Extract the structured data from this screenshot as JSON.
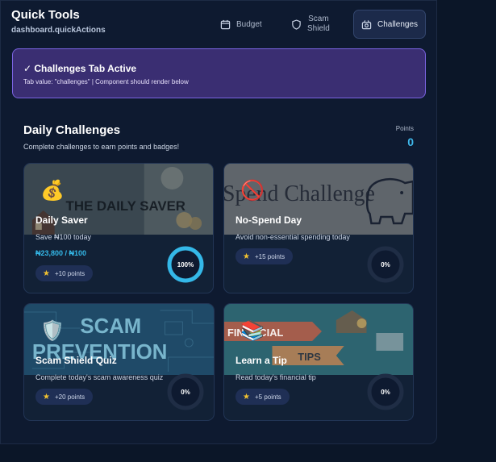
{
  "header": {
    "title": "Quick Tools",
    "subtitle": "dashboard.quickActions",
    "tabs": [
      {
        "label": "Budget",
        "icon": "calendar-icon"
      },
      {
        "label": "Scam Shield",
        "line1": "Scam",
        "line2": "Shield",
        "icon": "shield-icon"
      },
      {
        "label": "Challenges",
        "icon": "challenges-icon",
        "active": true
      }
    ]
  },
  "banner": {
    "title": "✓ Challenges Tab Active",
    "text": "Tab value: \"challenges\" | Component should render below"
  },
  "section": {
    "title": "Daily Challenges",
    "subtitle": "Complete challenges to earn points and badges!",
    "points_label": "Points",
    "points_value": "0"
  },
  "challenges": [
    {
      "title": "Daily Saver",
      "description": "Save ₦100 today",
      "progress_text": "₦23,800 / ₦100",
      "points": "+10 points",
      "percent": 100,
      "percent_label": "100%",
      "emoji": "💰",
      "emoji_icon": "money-bag-icon",
      "image_text": "THE DAILY SAVER"
    },
    {
      "title": "No-Spend Day",
      "description": "Avoid non-essential spending today",
      "points": "+15 points",
      "percent": 0,
      "percent_label": "0%",
      "emoji": "🚫",
      "emoji_icon": "prohibited-icon",
      "image_text": "Spend Challenge"
    },
    {
      "title": "Scam Shield Quiz",
      "description": "Complete today's scam awareness quiz",
      "points": "+20 points",
      "percent": 0,
      "percent_label": "0%",
      "emoji": "🛡️",
      "emoji_icon": "shield-icon",
      "image_line1": "SCAM",
      "image_line2": "PREVENTION"
    },
    {
      "title": "Learn a Tip",
      "description": "Read today's financial tip",
      "points": "+5 points",
      "percent": 0,
      "percent_label": "0%",
      "emoji": "📚",
      "emoji_icon": "books-icon",
      "image_line1": "FINANCIAL",
      "image_line2": "TIPS"
    }
  ],
  "colors": {
    "background": "#0b1628",
    "panel": "#0e1a30",
    "card": "#122136",
    "accent": "#34b8e8",
    "banner": "#3a2e72",
    "banner_border": "#7a63e0",
    "star": "#f2c230"
  }
}
